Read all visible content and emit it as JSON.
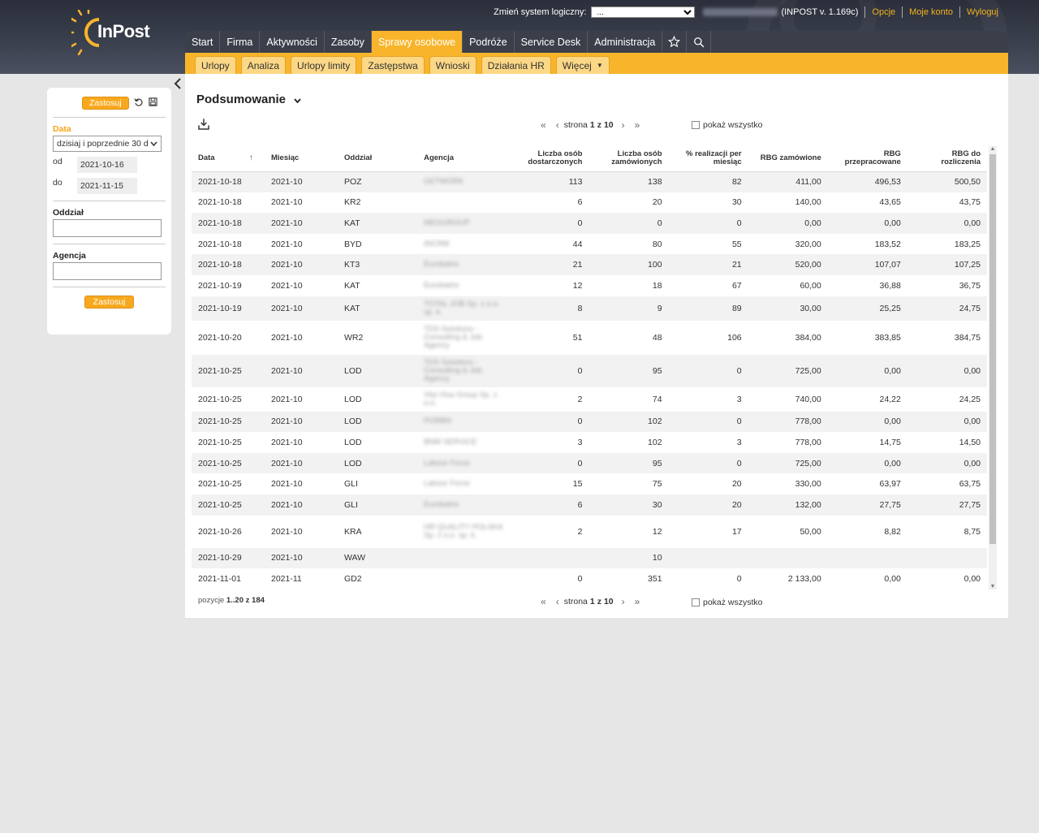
{
  "brand": {
    "logo_text": "InPost"
  },
  "topbar": {
    "system_label": "Zmień system logiczny:",
    "system_value": "...",
    "version": "(INPOST v. 1.169c)",
    "links": [
      "Opcje",
      "Moje konto",
      "Wyloguj"
    ]
  },
  "mainnav": {
    "items": [
      "Start",
      "Firma",
      "Aktywności",
      "Zasoby",
      "Sprawy osobowe",
      "Podróże",
      "Service Desk",
      "Administracja"
    ],
    "active": "Sprawy osobowe",
    "icons": [
      "star-icon",
      "search-icon"
    ]
  },
  "subnav": {
    "items": [
      "Urlopy",
      "Analiza",
      "Urlopy limity",
      "Zastępstwa",
      "Wnioski",
      "Działania HR"
    ],
    "more": "Więcej"
  },
  "sidebar": {
    "apply_label": "Zastosuj",
    "date_label": "Data",
    "date_range_value": "dzisiaj i poprzednie 30 d",
    "from_label": "od",
    "from_value": "2021-10-16",
    "to_label": "do",
    "to_value": "2021-11-15",
    "branch_label": "Oddział",
    "agency_label": "Agencja",
    "apply_bottom_label": "Zastosuj"
  },
  "page": {
    "title": "Podsumowanie"
  },
  "pagination": {
    "page_label": "strona",
    "page_current": "1",
    "page_of": "z",
    "page_total": "10",
    "show_all": "pokaż wszystko",
    "positions_label": "pozycje",
    "positions_range": "1..20",
    "positions_of": "z",
    "positions_total": "184"
  },
  "table": {
    "columns": [
      "Data",
      "Miesiąc",
      "Oddział",
      "Agencja",
      "Liczba osób dostarczonych",
      "Liczba osób zamówionych",
      "% realizacji per miesiąc",
      "RBG zamówione",
      "RBG przepracowane",
      "RBG do rozliczenia"
    ],
    "rows": [
      [
        "2021-10-18",
        "2021-10",
        "POZ",
        "GETWORK",
        "113",
        "138",
        "82",
        "411,00",
        "496,53",
        "500,50"
      ],
      [
        "2021-10-18",
        "2021-10",
        "KR2",
        "",
        "6",
        "20",
        "30",
        "140,00",
        "43,65",
        "43,75"
      ],
      [
        "2021-10-18",
        "2021-10",
        "KAT",
        "MEGGROUP",
        "0",
        "0",
        "0",
        "0,00",
        "0,00",
        "0,00"
      ],
      [
        "2021-10-18",
        "2021-10",
        "BYD",
        "INCRM",
        "44",
        "80",
        "55",
        "320,00",
        "183,52",
        "183,25"
      ],
      [
        "2021-10-18",
        "2021-10",
        "KT3",
        "Eurobatrix",
        "21",
        "100",
        "21",
        "520,00",
        "107,07",
        "107,25"
      ],
      [
        "2021-10-19",
        "2021-10",
        "KAT",
        "Eurobatrix",
        "12",
        "18",
        "67",
        "60,00",
        "36,88",
        "36,75"
      ],
      [
        "2021-10-19",
        "2021-10",
        "KAT",
        "TOTAL JOB Sp. z o.o. sp. k.",
        "8",
        "9",
        "89",
        "30,00",
        "25,25",
        "24,75"
      ],
      [
        "2021-10-20",
        "2021-10",
        "WR2",
        "TDS Solutions - Consulting & Job Agency",
        "51",
        "48",
        "106",
        "384,00",
        "383,85",
        "384,75"
      ],
      [
        "2021-10-25",
        "2021-10",
        "LOD",
        "TDS Solutions - Consulting & Job Agency",
        "0",
        "95",
        "0",
        "725,00",
        "0,00",
        "0,00"
      ],
      [
        "2021-10-25",
        "2021-10",
        "LOD",
        "Vita Visa Group Sp. z o.o.",
        "2",
        "74",
        "3",
        "740,00",
        "24,22",
        "24,25"
      ],
      [
        "2021-10-25",
        "2021-10",
        "LOD",
        "PORBN",
        "0",
        "102",
        "0",
        "778,00",
        "0,00",
        "0,00"
      ],
      [
        "2021-10-25",
        "2021-10",
        "LOD",
        "BNM SERVICE",
        "3",
        "102",
        "3",
        "778,00",
        "14,75",
        "14,50"
      ],
      [
        "2021-10-25",
        "2021-10",
        "LOD",
        "Labour Force",
        "0",
        "95",
        "0",
        "725,00",
        "0,00",
        "0,00"
      ],
      [
        "2021-10-25",
        "2021-10",
        "GLI",
        "Labour Force",
        "15",
        "75",
        "20",
        "330,00",
        "63,97",
        "63,75"
      ],
      [
        "2021-10-25",
        "2021-10",
        "GLI",
        "Eurobatrix",
        "6",
        "30",
        "20",
        "132,00",
        "27,75",
        "27,75"
      ],
      [
        "2021-10-26",
        "2021-10",
        "KRA",
        "HR QUALITY POLSKA Sp. z o.o. sp. k.",
        "2",
        "12",
        "17",
        "50,00",
        "8,82",
        "8,75"
      ],
      [
        "2021-10-29",
        "2021-10",
        "WAW",
        "",
        "",
        "10",
        "",
        "",
        "",
        ""
      ],
      [
        "2021-11-01",
        "2021-11",
        "GD2",
        "",
        "0",
        "351",
        "0",
        "2 133,00",
        "0,00",
        "0,00"
      ]
    ]
  },
  "colors": {
    "accent": "#f8b52b",
    "header_bg": "#2b2f3b",
    "nav_bg": "#3b3f4a",
    "link": "#f6b21a"
  }
}
